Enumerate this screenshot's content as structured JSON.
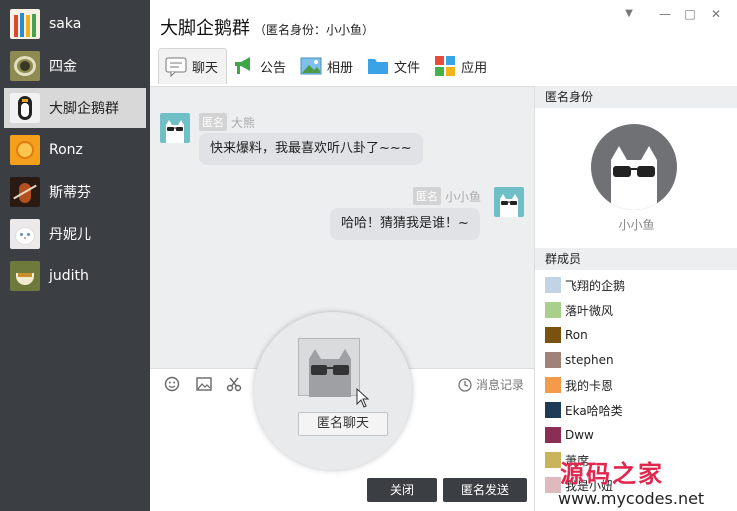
{
  "sidebar": {
    "contacts": [
      {
        "name": "saka",
        "icon": "pencils-avatar-icon",
        "color": "#d9492e"
      },
      {
        "name": "四金",
        "icon": "coiled-avatar-icon",
        "color": "#8d8a52"
      },
      {
        "name": "大脚企鹅群",
        "icon": "penguin-avatar-icon",
        "color": "#f2f2f2"
      },
      {
        "name": "Ronz",
        "icon": "orange-avatar-icon",
        "color": "#f5a01d"
      },
      {
        "name": "斯蒂芬",
        "icon": "violin-avatar-icon",
        "color": "#7a2d18"
      },
      {
        "name": "丹妮儿",
        "icon": "white-cat-avatar-icon",
        "color": "#ece9ea"
      },
      {
        "name": "judith",
        "icon": "tea-avatar-icon",
        "color": "#6d7a3c"
      }
    ]
  },
  "header": {
    "title": "大脚企鹅群",
    "subtitle": "（匿名身份：小小鱼）",
    "controls": {
      "dropdown": "▼",
      "minimize": "—",
      "maximize": "□",
      "close": "✕"
    }
  },
  "tabs": [
    {
      "label": "聊天",
      "icon": "chat-icon"
    },
    {
      "label": "公告",
      "icon": "megaphone-icon"
    },
    {
      "label": "相册",
      "icon": "photo-icon"
    },
    {
      "label": "文件",
      "icon": "folder-icon"
    },
    {
      "label": "应用",
      "icon": "apps-icon"
    }
  ],
  "messages": [
    {
      "tag": "匿名",
      "sender": "大熊",
      "text": "快来爆料，我最喜欢听八卦了~~~"
    },
    {
      "tag": "匿名",
      "sender": "小小鱼",
      "text": "哈哈！猜猜我是谁！~"
    }
  ],
  "anon_panel": {
    "header": "匿名身份",
    "name": "小小鱼"
  },
  "members": {
    "header": "群成员",
    "items": [
      {
        "name": "飞翔的企鹅",
        "color": "#c3d3e6"
      },
      {
        "name": "落叶微风",
        "color": "#a9cf8c"
      },
      {
        "name": "Ron",
        "color": "#7a5210"
      },
      {
        "name": "stephen",
        "color": "#a0827a"
      },
      {
        "name": "我的卡恩",
        "color": "#f49b4b"
      },
      {
        "name": "Eka哈哈类",
        "color": "#1d3a57"
      },
      {
        "name": "Dww",
        "color": "#8a2e55"
      },
      {
        "name": "萧席",
        "color": "#c9b45a"
      },
      {
        "name": "我是小妞",
        "color": "#e0b9be"
      }
    ]
  },
  "toolbar": {
    "history": "消息记录"
  },
  "popup": {
    "button": "匿名聊天"
  },
  "buttons": {
    "close": "关闭",
    "send": "匿名发送"
  },
  "watermark": {
    "title": "源码之家",
    "url": "www.mycodes.net"
  },
  "colors": {
    "sidebar_bg": "#3b3e43",
    "accent_teal": "#6fbfc7",
    "watermark_red": "#e0284f"
  }
}
